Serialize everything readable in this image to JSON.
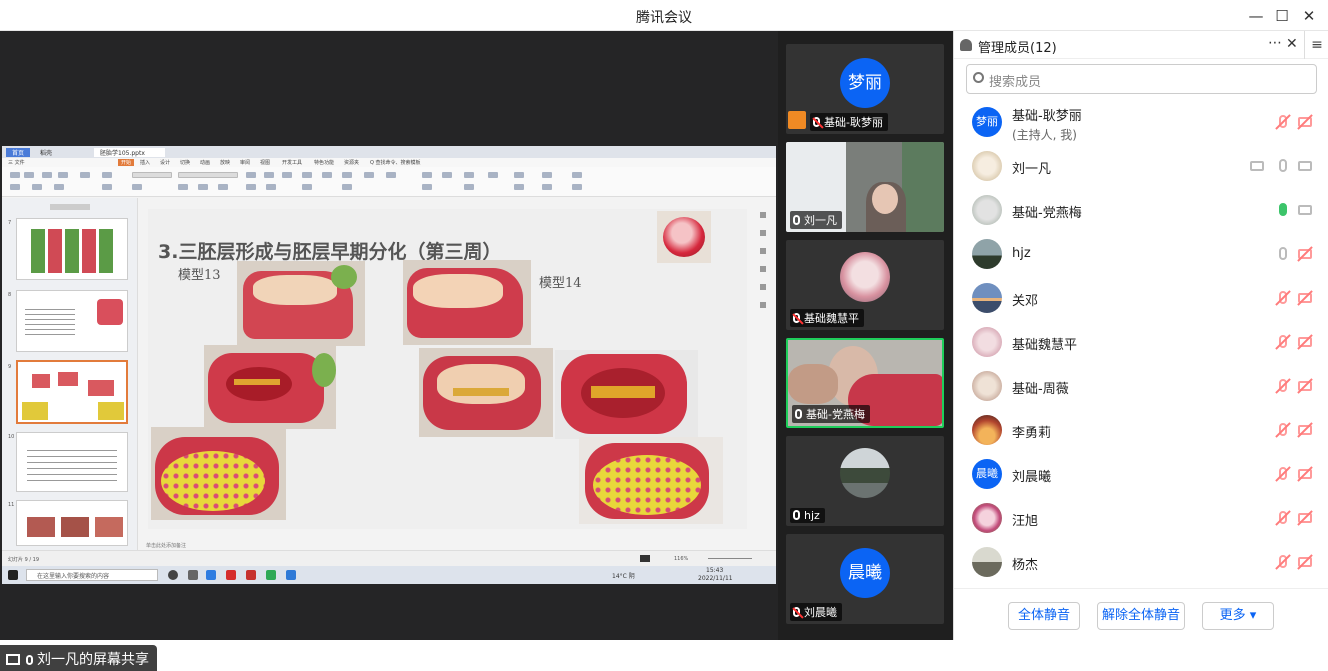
{
  "window": {
    "title": "腾讯会议"
  },
  "share": {
    "label": "刘一凡的屏幕共享",
    "app_tabs": [
      "首页",
      "稻壳",
      "胚胎学105.pptx"
    ],
    "menu": [
      "三 文件",
      "开始",
      "插入",
      "设计",
      "切换",
      "动画",
      "放映",
      "审阅",
      "视图",
      "开发工具",
      "特色功能",
      "资源夹",
      "Q 查找命令、搜索模板"
    ],
    "thumb_numbers": [
      "7",
      "8",
      "9",
      "10",
      "11"
    ],
    "slide": {
      "title": "3.三胚层形成与胚层早期分化（第三周）",
      "label_left": "模型13",
      "label_right": "模型14"
    },
    "notes_placeholder": "单击此处添加备注",
    "status_left": "幻灯片 9 / 19",
    "status_zoom": "116%",
    "taskbar_search": "在这里输入你要搜索的内容",
    "weather": "14°C 阴",
    "clock_time": "15:43",
    "clock_date": "2022/11/11"
  },
  "tiles": [
    {
      "name": "基础-耿梦丽",
      "avatar_text": "梦丽",
      "mic_muted": true,
      "host": true
    },
    {
      "name": "刘一凡",
      "mic_muted": false
    },
    {
      "name": "基础魏慧平",
      "mic_muted": true
    },
    {
      "name": "基础-党燕梅",
      "mic_muted": false,
      "active": true
    },
    {
      "name": "hjz",
      "mic_muted": false
    },
    {
      "name": "刘晨曦",
      "avatar_text": "晨曦",
      "mic_muted": true
    }
  ],
  "panel": {
    "title": "管理成员(12)",
    "search_placeholder": "搜索成员",
    "members": [
      {
        "name": "基础-耿梦丽",
        "sub": "(主持人, 我)",
        "avatar_text": "梦丽",
        "mic": "muted",
        "cam": "off"
      },
      {
        "name": "刘一凡",
        "mic": "on",
        "cam": "on",
        "share": true
      },
      {
        "name": "基础-党燕梅",
        "mic": "speaking",
        "cam": "on"
      },
      {
        "name": "hjz",
        "mic": "on",
        "cam": "off"
      },
      {
        "name": "关邓",
        "mic": "muted",
        "cam": "off"
      },
      {
        "name": "基础魏慧平",
        "mic": "muted",
        "cam": "off"
      },
      {
        "name": "基础-周薇",
        "mic": "muted",
        "cam": "off"
      },
      {
        "name": "李勇莉",
        "mic": "muted",
        "cam": "off"
      },
      {
        "name": "刘晨曦",
        "avatar_text": "晨曦",
        "mic": "muted",
        "cam": "off"
      },
      {
        "name": "汪旭",
        "mic": "muted",
        "cam": "off"
      },
      {
        "name": "杨杰",
        "mic": "muted",
        "cam": "off"
      }
    ],
    "buttons": {
      "mute_all": "全体静音",
      "unmute_all": "解除全体静音",
      "more": "更多 ▾"
    }
  },
  "colors": {
    "accent": "#0b64f4",
    "active_border": "#1fce5b",
    "mute_red": "#ff7b7b"
  }
}
